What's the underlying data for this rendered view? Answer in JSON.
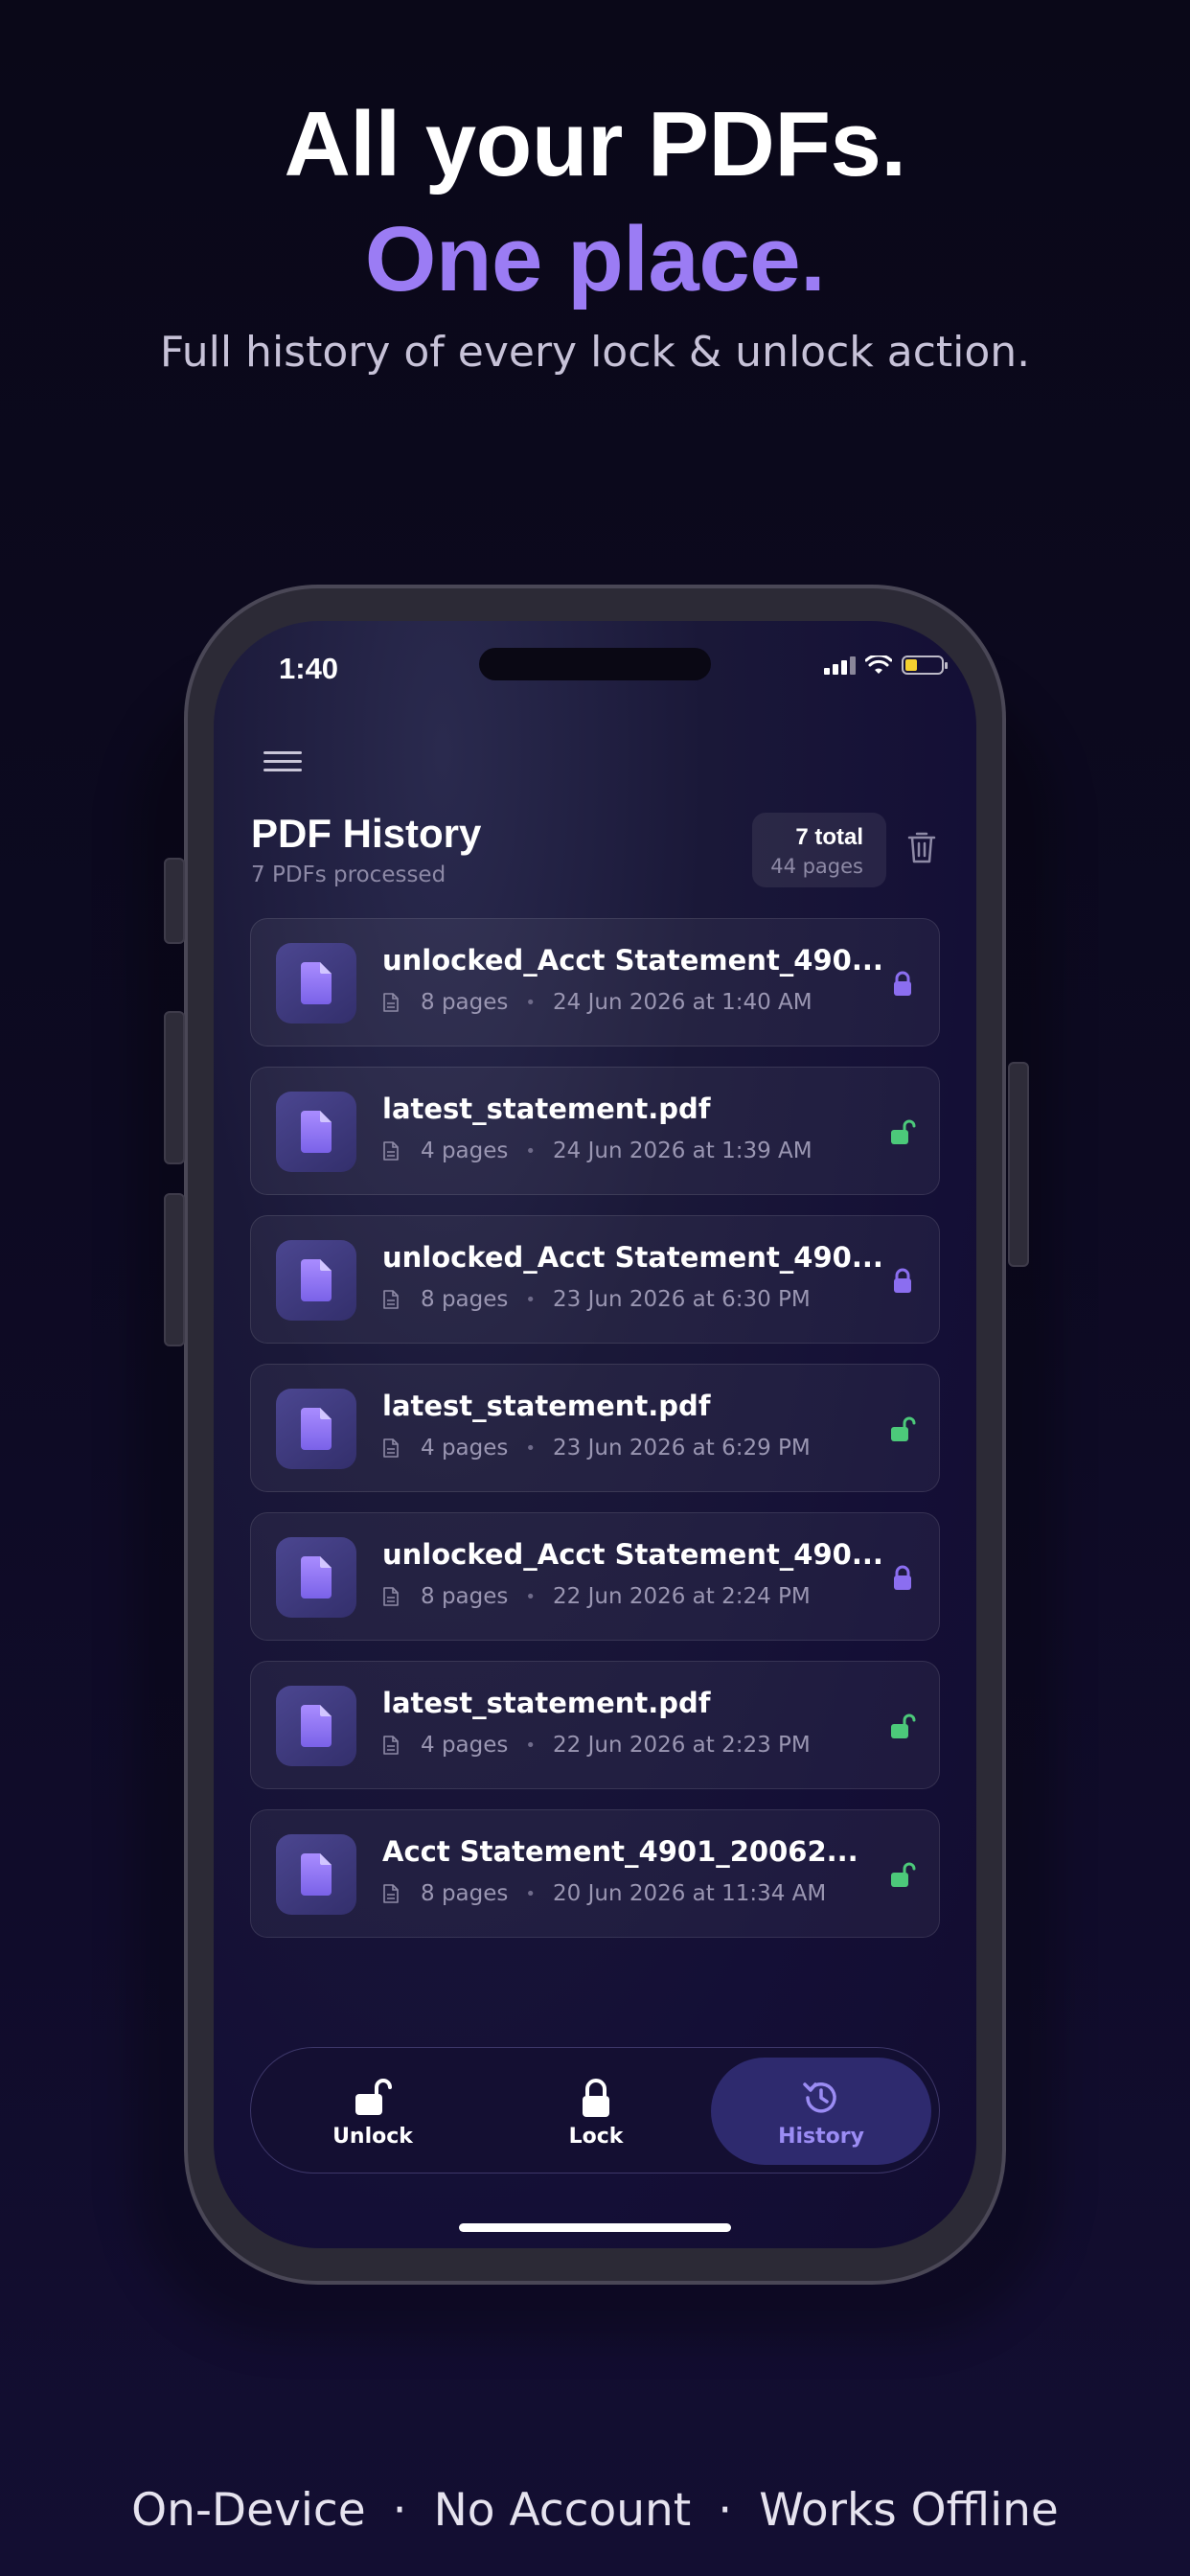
{
  "hero": {
    "line1": "All your PDFs.",
    "line2": "One place.",
    "subtitle": "Full history of every lock & unlock action."
  },
  "status_bar": {
    "time": "1:40"
  },
  "screen": {
    "title": "PDF History",
    "subtitle": "7 PDFs processed",
    "total_label": "7 total",
    "pages_label": "44 pages"
  },
  "history": [
    {
      "name": "unlocked_Acct Statement_490...",
      "pages": "8 pages",
      "date": "24 Jun 2026 at 1:40 AM",
      "status": "locked"
    },
    {
      "name": "latest_statement.pdf",
      "pages": "4 pages",
      "date": "24 Jun 2026 at 1:39 AM",
      "status": "unlocked"
    },
    {
      "name": "unlocked_Acct Statement_490...",
      "pages": "8 pages",
      "date": "23 Jun 2026 at 6:30 PM",
      "status": "locked"
    },
    {
      "name": "latest_statement.pdf",
      "pages": "4 pages",
      "date": "23 Jun 2026 at 6:29 PM",
      "status": "unlocked"
    },
    {
      "name": "unlocked_Acct Statement_490...",
      "pages": "8 pages",
      "date": "22 Jun 2026 at 2:24 PM",
      "status": "locked"
    },
    {
      "name": "latest_statement.pdf",
      "pages": "4 pages",
      "date": "22 Jun 2026 at 2:23 PM",
      "status": "unlocked"
    },
    {
      "name": "Acct Statement_4901_20062...",
      "pages": "8 pages",
      "date": "20 Jun 2026 at 11:34 AM",
      "status": "unlocked"
    }
  ],
  "tabs": [
    {
      "label": "Unlock",
      "icon": "unlock-icon"
    },
    {
      "label": "Lock",
      "icon": "lock-icon"
    },
    {
      "label": "History",
      "icon": "history-icon",
      "active": true
    }
  ],
  "footer": {
    "item1": "On-Device",
    "item2": "No Account",
    "item3": "Works Offline",
    "separator": "·"
  },
  "colors": {
    "accent": "#9b7cf4",
    "locked": "#8b6ef0",
    "unlocked": "#4cc97a"
  }
}
